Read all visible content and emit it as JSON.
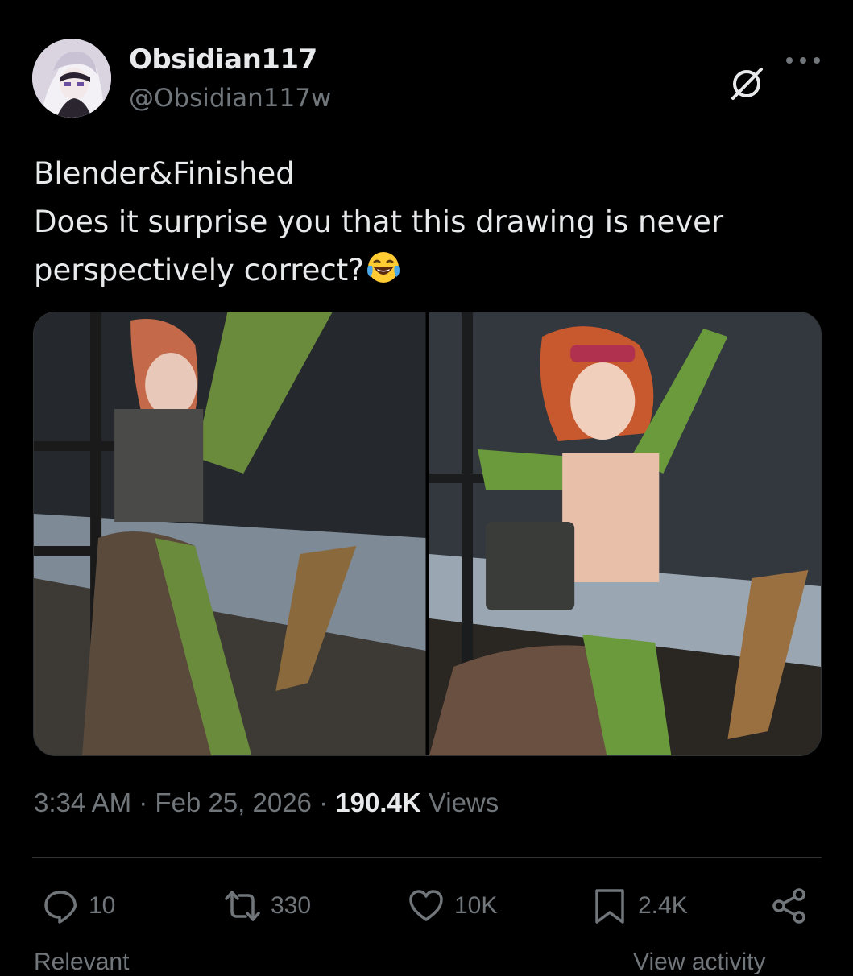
{
  "author": {
    "display_name": "Obsidian117",
    "handle": "@Obsidian117w"
  },
  "header_icons": [
    "grok-icon",
    "more-icon"
  ],
  "tweet": {
    "line1": "Blender&Finished",
    "line2": "Does it surprise you that this drawing is never",
    "line3": "perspectively correct?",
    "emoji": "face-with-tears-of-joy"
  },
  "media": {
    "count": 2
  },
  "meta": {
    "time": "3:34 AM",
    "sep1": " · ",
    "date": "Feb 25, 2026",
    "sep2": " · ",
    "views_count": "190.4K",
    "views_label": " Views"
  },
  "actions": {
    "replies": "10",
    "reposts": "330",
    "likes": "10K",
    "bookmarks": "2.4K"
  },
  "footer": {
    "relevant": "Relevant",
    "view_activity": "View activity"
  },
  "colors": {
    "background": "#000000",
    "text": "#e7e9ea",
    "secondary": "#71767b",
    "divider": "#2f3336"
  }
}
